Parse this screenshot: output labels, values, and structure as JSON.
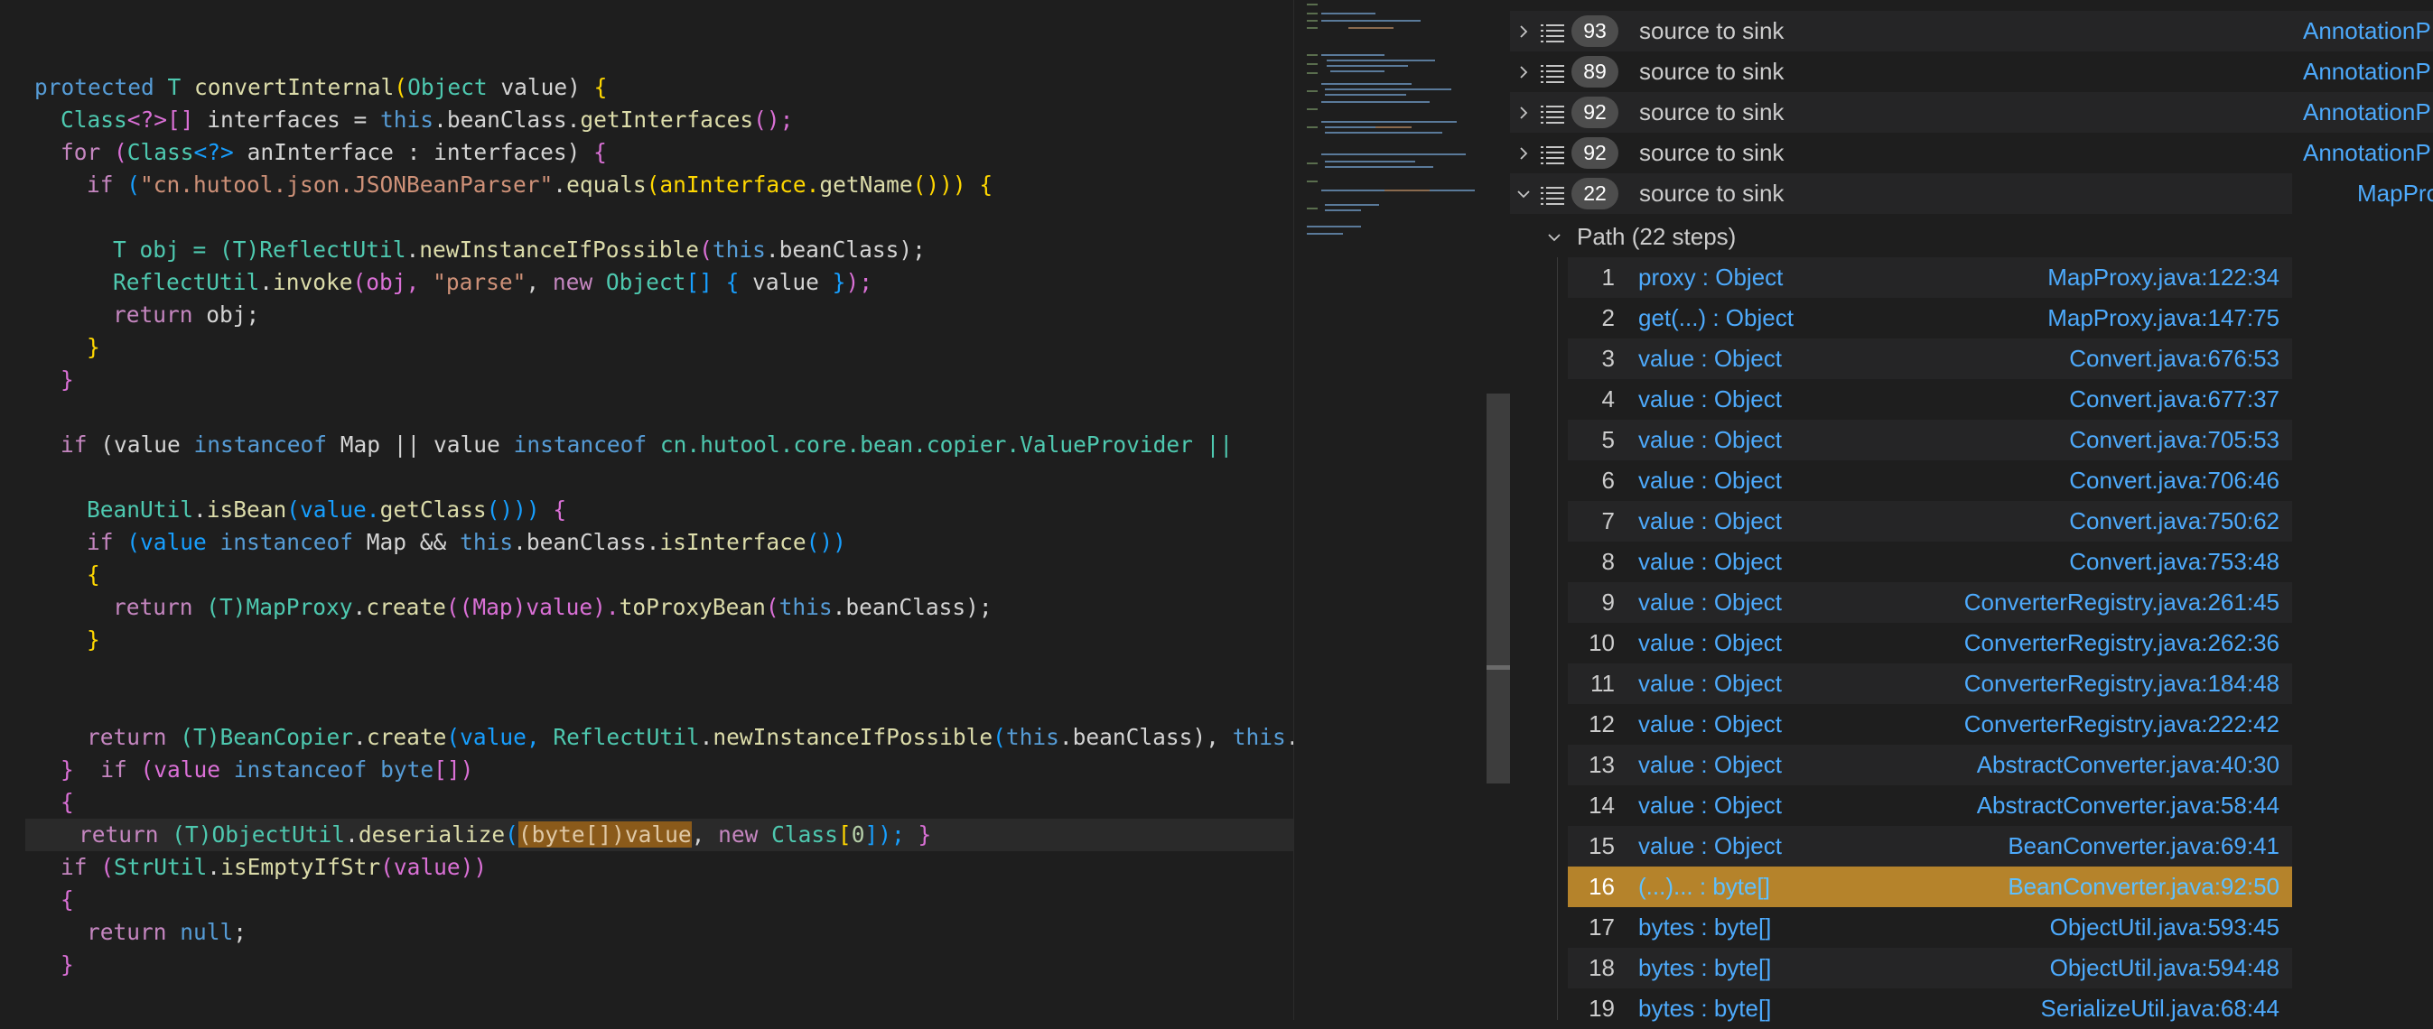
{
  "code": {
    "sig_protected": "protected",
    "sig_T": " T ",
    "sig_name": "convertInternal",
    "sig_p1": "(",
    "sig_objtype": "Object",
    "sig_param": " value) ",
    "sig_brace": "{",
    "l2_class": "Class",
    "l2_gen": "<?>[]",
    "l2_var": " interfaces = ",
    "l2_this": "this",
    "l2_rest": ".beanClass.",
    "l2_fn": "getInterfaces",
    "l2_end": "();",
    "l3_for": "for",
    "l3_p": " (",
    "l3_class": "Class",
    "l3_gen": "<?>",
    "l3_var": " anInterface : interfaces) ",
    "l3_brace": "{",
    "l4_if": "if",
    "l4_p": " (",
    "l4_str": "\"cn.hutool.json.JSONBeanParser\"",
    "l4_dot": ".",
    "l4_equals": "equals",
    "l4_p2": "(anInterface.",
    "l4_getName": "getName",
    "l4_end": "())) ",
    "l4_brace": "{",
    "l6_T": "T obj = (T)",
    "l6_cls": "ReflectUtil",
    "l6_dot": ".",
    "l6_fn": "newInstanceIfPossible",
    "l6_p": "(",
    "l6_this": "this",
    "l6_rest": ".beanClass);",
    "l7_cls": "ReflectUtil",
    "l7_dot": ".",
    "l7_fn": "invoke",
    "l7_p": "(obj, ",
    "l7_str": "\"parse\"",
    "l7_c": ", ",
    "l7_new": "new",
    "l7_obj": " Object",
    "l7_arr": "[] ",
    "l7_b1": "{",
    "l7_val": " value ",
    "l7_b2": "}",
    "l7_end": ");",
    "l8_return": "return",
    "l8_rest": " obj;",
    "close_brace": "}",
    "l11_if": "if",
    "l11_p": " (value ",
    "l11_inst": "instanceof",
    "l11_map": " Map || value ",
    "l11_inst2": "instanceof",
    "l11_pkg": " cn.hutool.core.bean.copier.ValueProvider ||",
    "l13_cls": "BeanUtil",
    "l13_dot": ".",
    "l13_fn": "isBean",
    "l13_p": "(value.",
    "l13_fn2": "getClass",
    "l13_end": "())) ",
    "l13_brace": "{",
    "l14_if": "if",
    "l14_p": " (value ",
    "l14_inst": "instanceof",
    "l14_map": " Map && ",
    "l14_this": "this",
    "l14_rest": ".beanClass.",
    "l14_fn": "isInterface",
    "l14_end": "())",
    "l15_brace": "{",
    "l16_return": "return",
    "l16_cast": " (T)",
    "l16_cls": "MapProxy",
    "l16_dot": ".",
    "l16_fn": "create",
    "l16_p": "((Map)value).",
    "l16_fn2": "toProxyBean",
    "l16_p2": "(",
    "l16_this": "this",
    "l16_end": ".beanClass);",
    "l20_return": "return",
    "l20_cast": " (T)",
    "l20_cls": "BeanCopier",
    "l20_dot": ".",
    "l20_fn": "create",
    "l20_p": "(value, ",
    "l20_cls2": "ReflectUtil",
    "l20_dot2": ".",
    "l20_fn2": "newInstanceIfPossible",
    "l20_p2": "(",
    "l20_this": "this",
    "l20_mid": ".beanClass), ",
    "l20_this2": "this",
    "l20_end": ".be",
    "l21_brace": "}",
    "l21_if": "  if",
    "l21_p": " (value ",
    "l21_inst": "instanceof",
    "l21_byte": " byte",
    "l21_end": "[])",
    "l22_brace": "{",
    "l23_return": "return",
    "l23_cast": " (T)",
    "l23_cls": "ObjectUtil",
    "l23_dot": ".",
    "l23_fn": "deserialize",
    "l23_p": "(",
    "l23_hl": "(byte[])value",
    "l23_c": ", ",
    "l23_new": "new",
    "l23_class": " Class",
    "l23_arr": "[",
    "l23_zero": "0",
    "l23_end": "]); ",
    "l23_brace": "}",
    "l24_if": "if",
    "l24_p": " (",
    "l24_cls": "StrUtil",
    "l24_dot": ".",
    "l24_fn": "isEmptyIfStr",
    "l24_end": "(value))",
    "l25_brace": "{",
    "l26_return": "return",
    "l26_null": " null",
    "l26_end": ";",
    "l27_brace": "}"
  },
  "results": [
    {
      "count": "93",
      "message": "source to sink",
      "location": "AnnotationP"
    },
    {
      "count": "89",
      "message": "source to sink",
      "location": "AnnotationP"
    },
    {
      "count": "92",
      "message": "source to sink",
      "location": "AnnotationP"
    },
    {
      "count": "92",
      "message": "source to sink",
      "location": "AnnotationP"
    },
    {
      "count": "22",
      "message": "source to sink",
      "location": "MapPro"
    }
  ],
  "path": {
    "label": "Path (22 steps)",
    "steps": [
      {
        "n": "1",
        "label": "proxy : Object",
        "loc": "MapProxy.java:122:34"
      },
      {
        "n": "2",
        "label": "get(...) : Object",
        "loc": "MapProxy.java:147:75"
      },
      {
        "n": "3",
        "label": "value : Object",
        "loc": "Convert.java:676:53"
      },
      {
        "n": "4",
        "label": "value : Object",
        "loc": "Convert.java:677:37"
      },
      {
        "n": "5",
        "label": "value : Object",
        "loc": "Convert.java:705:53"
      },
      {
        "n": "6",
        "label": "value : Object",
        "loc": "Convert.java:706:46"
      },
      {
        "n": "7",
        "label": "value : Object",
        "loc": "Convert.java:750:62"
      },
      {
        "n": "8",
        "label": "value : Object",
        "loc": "Convert.java:753:48"
      },
      {
        "n": "9",
        "label": "value : Object",
        "loc": "ConverterRegistry.java:261:45"
      },
      {
        "n": "10",
        "label": "value : Object",
        "loc": "ConverterRegistry.java:262:36"
      },
      {
        "n": "11",
        "label": "value : Object",
        "loc": "ConverterRegistry.java:184:48"
      },
      {
        "n": "12",
        "label": "value : Object",
        "loc": "ConverterRegistry.java:222:42"
      },
      {
        "n": "13",
        "label": "value : Object",
        "loc": "AbstractConverter.java:40:30"
      },
      {
        "n": "14",
        "label": "value : Object",
        "loc": "AbstractConverter.java:58:44"
      },
      {
        "n": "15",
        "label": "value : Object",
        "loc": "BeanConverter.java:69:41"
      },
      {
        "n": "16",
        "label": "(...)... : byte[]",
        "loc": "BeanConverter.java:92:50"
      },
      {
        "n": "17",
        "label": "bytes : byte[]",
        "loc": "ObjectUtil.java:593:45"
      },
      {
        "n": "18",
        "label": "bytes : byte[]",
        "loc": "ObjectUtil.java:594:48"
      },
      {
        "n": "19",
        "label": "bytes : byte[]",
        "loc": "SerializeUtil.java:68:44"
      }
    ]
  },
  "colors": {
    "selected_row": "#b5832b",
    "link": "#4daafc",
    "badge": "#4d4d4d",
    "code_highlight": "#8a5a1a"
  },
  "icons": [
    "chevron-right-icon",
    "chevron-down-icon",
    "list-icon"
  ]
}
